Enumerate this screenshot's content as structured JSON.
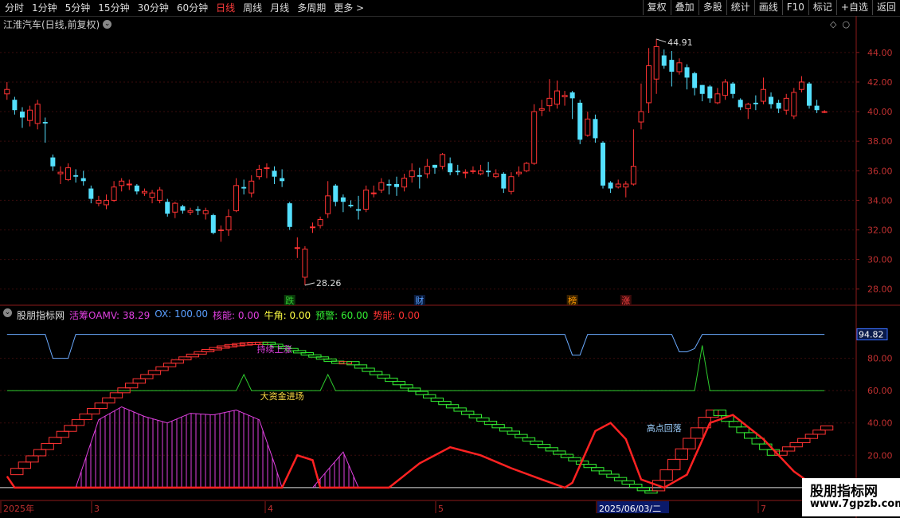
{
  "toolbar": {
    "periods": [
      {
        "label": "分时",
        "active": false
      },
      {
        "label": "1分钟",
        "active": false
      },
      {
        "label": "5分钟",
        "active": false
      },
      {
        "label": "15分钟",
        "active": false
      },
      {
        "label": "30分钟",
        "active": false
      },
      {
        "label": "60分钟",
        "active": false
      },
      {
        "label": "日线",
        "active": true
      },
      {
        "label": "周线",
        "active": false
      },
      {
        "label": "月线",
        "active": false
      },
      {
        "label": "多周期",
        "active": false
      },
      {
        "label": "更多 >",
        "active": false
      }
    ],
    "right_buttons": [
      "复权",
      "叠加",
      "多股",
      "统计",
      "画线",
      "F10",
      "标记",
      "+自选",
      "返回"
    ]
  },
  "chart_title": "江淮汽车(日线,前复权)",
  "price_chart": {
    "ylim": [
      27.5,
      45.5
    ],
    "yticks": [
      "44.00",
      "42.00",
      "40.00",
      "38.00",
      "36.00",
      "34.00",
      "32.00",
      "30.00",
      "28.00"
    ],
    "high_label": "44.91",
    "low_label": "28.26",
    "markers": [
      {
        "text": "跌",
        "color": "#33cc33",
        "bg": "#0a3a0a"
      },
      {
        "text": "财",
        "color": "#5aa0ff",
        "bg": "#0a1a3a"
      },
      {
        "text": "榜",
        "color": "#ff9900",
        "bg": "#3a2200"
      },
      {
        "text": "涨",
        "color": "#ff4444",
        "bg": "#3a0a0a"
      }
    ],
    "candles": [
      [
        41.2,
        41.5,
        42.0,
        40.8
      ],
      [
        40.8,
        40.1,
        41.0,
        39.8
      ],
      [
        40.0,
        39.6,
        40.3,
        38.9
      ],
      [
        39.4,
        40.1,
        40.4,
        39.0
      ],
      [
        39.2,
        40.5,
        40.8,
        38.8
      ],
      [
        39.3,
        39.2,
        39.6,
        37.9
      ],
      [
        36.9,
        36.3,
        37.1,
        36.0
      ],
      [
        35.8,
        35.9,
        36.3,
        35.1
      ],
      [
        35.4,
        36.2,
        36.5,
        35.3
      ],
      [
        35.7,
        35.6,
        36.1,
        35.2
      ],
      [
        35.5,
        35.3,
        36.0,
        35.0
      ],
      [
        34.8,
        34.1,
        35.0,
        33.8
      ],
      [
        33.8,
        34.0,
        34.3,
        33.6
      ],
      [
        33.7,
        34.0,
        34.4,
        33.4
      ],
      [
        34.0,
        34.9,
        35.3,
        33.9
      ],
      [
        35.0,
        35.3,
        35.5,
        34.6
      ],
      [
        35.1,
        35.1,
        35.4,
        34.7
      ],
      [
        35.0,
        34.6,
        35.1,
        34.4
      ],
      [
        34.5,
        34.6,
        34.8,
        34.3
      ],
      [
        34.2,
        34.5,
        34.7,
        33.8
      ],
      [
        34.0,
        34.7,
        34.9,
        33.8
      ],
      [
        33.9,
        33.1,
        34.1,
        32.9
      ],
      [
        33.2,
        33.8,
        33.9,
        32.8
      ],
      [
        33.6,
        33.3,
        33.7,
        33.1
      ],
      [
        33.2,
        33.3,
        33.5,
        33.0
      ],
      [
        33.4,
        33.3,
        33.6,
        33.0
      ],
      [
        33.1,
        33.3,
        33.5,
        32.7
      ],
      [
        33.0,
        31.8,
        33.1,
        31.7
      ],
      [
        32.0,
        32.0,
        32.3,
        31.2
      ],
      [
        32.0,
        32.9,
        33.4,
        31.6
      ],
      [
        33.3,
        35.0,
        35.5,
        33.2
      ],
      [
        34.9,
        34.8,
        35.4,
        34.4
      ],
      [
        34.5,
        35.3,
        35.7,
        34.2
      ],
      [
        35.6,
        36.1,
        36.4,
        35.4
      ],
      [
        36.2,
        36.2,
        36.5,
        35.5
      ],
      [
        36.0,
        35.6,
        36.3,
        35.1
      ],
      [
        35.5,
        35.3,
        36.1,
        34.9
      ],
      [
        33.8,
        32.2,
        33.9,
        32.0
      ],
      [
        30.8,
        30.8,
        31.5,
        30.1
      ],
      [
        28.8,
        30.7,
        30.9,
        28.26
      ],
      [
        32.2,
        32.2,
        32.5,
        31.8
      ],
      [
        32.3,
        32.7,
        32.9,
        32.1
      ],
      [
        33.1,
        34.3,
        35.3,
        32.8
      ],
      [
        35.0,
        33.9,
        35.1,
        33.6
      ],
      [
        34.2,
        33.9,
        34.4,
        33.2
      ],
      [
        33.7,
        33.6,
        34.0,
        33.5
      ],
      [
        33.4,
        33.3,
        34.3,
        32.7
      ],
      [
        33.4,
        34.7,
        35.0,
        33.2
      ],
      [
        34.5,
        34.5,
        35.0,
        34.2
      ],
      [
        34.7,
        35.2,
        35.5,
        34.5
      ],
      [
        35.1,
        35.0,
        35.4,
        34.4
      ],
      [
        35.1,
        34.9,
        35.6,
        34.3
      ],
      [
        34.9,
        35.5,
        35.8,
        34.6
      ],
      [
        35.6,
        36.0,
        36.5,
        35.2
      ],
      [
        35.7,
        35.6,
        36.2,
        34.8
      ],
      [
        35.8,
        36.3,
        36.8,
        35.5
      ],
      [
        36.4,
        36.2,
        36.4,
        35.8
      ],
      [
        36.3,
        37.1,
        37.2,
        36.1
      ],
      [
        36.5,
        35.9,
        36.9,
        35.7
      ],
      [
        36.0,
        35.9,
        36.4,
        35.7
      ],
      [
        35.9,
        35.9,
        36.1,
        35.5
      ],
      [
        36.0,
        36.0,
        36.3,
        35.8
      ],
      [
        35.8,
        36.0,
        36.4,
        35.7
      ],
      [
        36.0,
        35.9,
        36.6,
        35.6
      ],
      [
        35.6,
        35.8,
        36.1,
        35.5
      ],
      [
        35.8,
        34.8,
        35.9,
        34.5
      ],
      [
        34.6,
        35.6,
        35.9,
        34.4
      ],
      [
        35.8,
        35.9,
        36.3,
        35.6
      ],
      [
        36.0,
        36.5,
        36.6,
        35.9
      ],
      [
        36.5,
        40.0,
        40.5,
        36.4
      ],
      [
        40.1,
        40.2,
        40.8,
        39.7
      ],
      [
        40.4,
        40.9,
        42.2,
        40.0
      ],
      [
        40.5,
        41.4,
        42.1,
        40.2
      ],
      [
        41.0,
        41.1,
        41.4,
        40.4
      ],
      [
        41.3,
        40.9,
        41.4,
        39.5
      ],
      [
        40.6,
        38.1,
        40.8,
        37.8
      ],
      [
        38.4,
        39.5,
        40.0,
        38.3
      ],
      [
        39.5,
        38.2,
        39.8,
        37.9
      ],
      [
        37.9,
        35.0,
        38.0,
        34.8
      ],
      [
        35.2,
        34.8,
        35.3,
        34.5
      ],
      [
        34.9,
        35.1,
        35.4,
        34.8
      ],
      [
        34.9,
        35.1,
        35.3,
        34.2
      ],
      [
        35.1,
        36.3,
        38.8,
        35.0
      ],
      [
        39.3,
        40.0,
        41.9,
        38.8
      ],
      [
        40.6,
        43.1,
        44.3,
        39.9
      ],
      [
        42.2,
        44.4,
        44.91,
        41.2
      ],
      [
        43.8,
        43.1,
        44.2,
        42.9
      ],
      [
        43.5,
        42.7,
        44.1,
        41.7
      ],
      [
        42.7,
        43.3,
        43.6,
        42.5
      ],
      [
        43.0,
        42.3,
        43.2,
        41.5
      ],
      [
        42.6,
        41.6,
        42.7,
        41.1
      ],
      [
        41.8,
        41.2,
        41.8,
        40.7
      ],
      [
        41.7,
        40.9,
        41.8,
        40.6
      ],
      [
        40.6,
        41.2,
        41.6,
        40.5
      ],
      [
        41.1,
        42.0,
        42.2,
        40.8
      ],
      [
        41.9,
        41.2,
        42.0,
        40.9
      ],
      [
        40.8,
        40.3,
        40.9,
        40.1
      ],
      [
        40.2,
        40.5,
        40.6,
        39.5
      ],
      [
        40.6,
        40.5,
        41.1,
        40.1
      ],
      [
        40.7,
        41.5,
        42.3,
        40.5
      ],
      [
        41.0,
        40.5,
        41.3,
        40.2
      ],
      [
        40.6,
        40.2,
        40.8,
        39.9
      ],
      [
        40.1,
        40.9,
        41.2,
        39.8
      ],
      [
        39.7,
        41.3,
        41.6,
        39.5
      ],
      [
        41.5,
        42.0,
        42.4,
        41.3
      ],
      [
        41.9,
        40.4,
        42.0,
        40.2
      ],
      [
        40.4,
        40.1,
        40.8,
        39.9
      ],
      [
        40.0,
        40.0,
        40.1,
        39.9
      ]
    ]
  },
  "indicator": {
    "name": "股朋指标网",
    "values": [
      {
        "text": "活筹OAMV: 38.29",
        "color": "#e040e0"
      },
      {
        "text": "OX: 100.00",
        "color": "#5a9fff"
      },
      {
        "text": "核能: 0.00",
        "color": "#e040e0"
      },
      {
        "text": "牛角: 0.00",
        "color": "#ffff44"
      },
      {
        "text": "预警: 60.00",
        "color": "#33ee33"
      },
      {
        "text": "势能: 0.00",
        "color": "#ff3333"
      }
    ],
    "ylim": [
      -5,
      102
    ],
    "yticks": [
      "80.00",
      "60.00",
      "40.00",
      "20.00"
    ],
    "current_value": "94.82",
    "annotations": [
      "持续上涨",
      "大资金进场",
      "高点回落"
    ]
  },
  "x_axis": {
    "labels": [
      "2025年",
      "3",
      "4",
      "5",
      "2025/06/03/二",
      "7"
    ]
  },
  "watermark": {
    "line1": "股朋指标网",
    "line2": "www.7gpzb.com"
  }
}
